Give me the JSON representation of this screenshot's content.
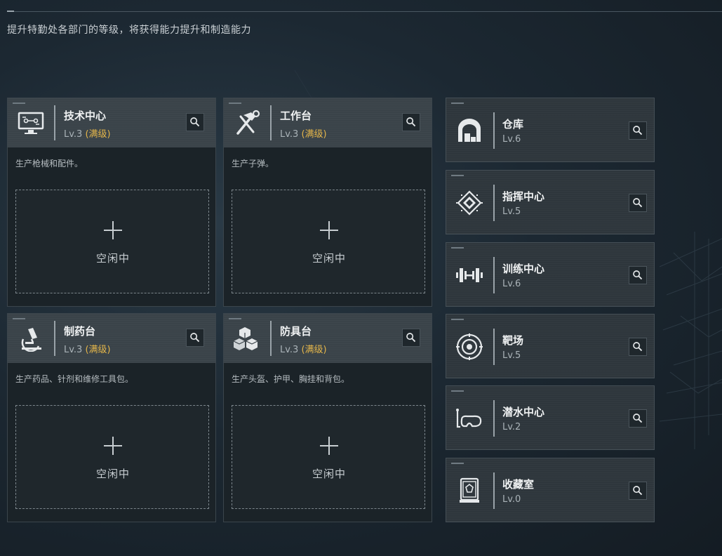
{
  "header": {
    "subtitle": "提升特勤处各部门的等级，将获得能力提升和制造能力"
  },
  "workshops": [
    {
      "name": "技术中心",
      "level": "Lv.3",
      "status": "(满级)",
      "description": "生产枪械和配件。",
      "slot_label": "空闲中",
      "icon": "monitor-icon"
    },
    {
      "name": "工作台",
      "level": "Lv.3",
      "status": "(满级)",
      "description": "生产子弹。",
      "slot_label": "空闲中",
      "icon": "hammer-wrench-icon"
    },
    {
      "name": "制药台",
      "level": "Lv.3",
      "status": "(满级)",
      "description": "生产药品、针剂和维修工具包。",
      "slot_label": "空闲中",
      "icon": "microscope-icon"
    },
    {
      "name": "防具台",
      "level": "Lv.3",
      "status": "(满级)",
      "description": "生产头盔、护甲、胸挂和背包。",
      "slot_label": "空闲中",
      "icon": "cubes-icon"
    }
  ],
  "facilities": [
    {
      "name": "仓库",
      "level": "Lv.6",
      "icon": "warehouse-icon"
    },
    {
      "name": "指挥中心",
      "level": "Lv.5",
      "icon": "chip-icon"
    },
    {
      "name": "训练中心",
      "level": "Lv.6",
      "icon": "dumbbell-icon"
    },
    {
      "name": "靶场",
      "level": "Lv.5",
      "icon": "target-icon"
    },
    {
      "name": "潜水中心",
      "level": "Lv.2",
      "icon": "diving-mask-icon"
    },
    {
      "name": "收藏室",
      "level": "Lv.0",
      "icon": "display-case-icon"
    }
  ],
  "colors": {
    "maxed": "#e3b54a",
    "card_header": "#3a4349",
    "card_body": "#1b2328"
  }
}
